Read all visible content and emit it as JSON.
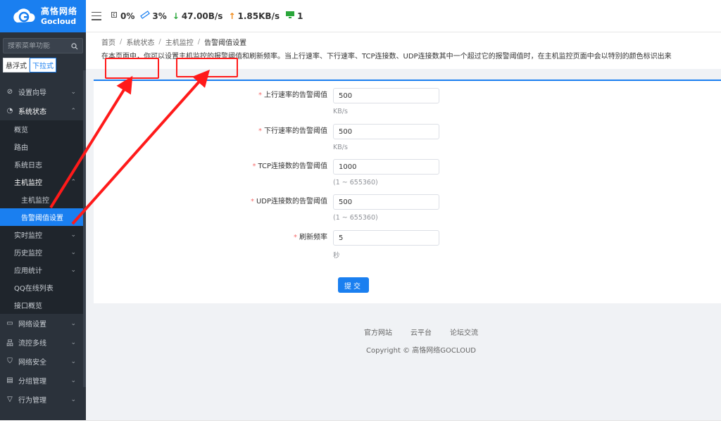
{
  "brand": {
    "cn": "高恪网络",
    "en": "Gocloud"
  },
  "sidebar": {
    "search_placeholder": "搜索菜单功能",
    "mode_float": "悬浮式",
    "mode_dropdown": "下拉式",
    "menu": [
      {
        "label": "设置向导",
        "icon": "compass-icon"
      },
      {
        "label": "系统状态",
        "icon": "gauge-icon"
      }
    ],
    "system_status_items": [
      "概览",
      "路由",
      "系统日志"
    ],
    "host_monitor": "主机监控",
    "host_monitor_items": [
      "主机监控",
      "告警阈值设置"
    ],
    "more_sub": [
      "实时监控",
      "历史监控",
      "应用统计",
      "QQ在线列表",
      "接口概览"
    ],
    "bottom_menu": [
      {
        "label": "网络设置",
        "icon": "monitor-icon"
      },
      {
        "label": "流控多线",
        "icon": "network-icon"
      },
      {
        "label": "网络安全",
        "icon": "shield-icon"
      },
      {
        "label": "分组管理",
        "icon": "document-icon"
      },
      {
        "label": "行为管理",
        "icon": "filter-icon"
      }
    ]
  },
  "topbar": {
    "cpu": "0%",
    "mem": "3%",
    "down": "47.00B/s",
    "up": "1.85KB/s",
    "devices": "1",
    "colors": {
      "down": "#2aa63a",
      "up": "#f08a1a",
      "device": "#2aa63a"
    }
  },
  "breadcrumb": [
    "首页",
    "系统状态",
    "主机监控",
    "告警阈值设置"
  ],
  "description": "在本页面中，你可以设置主机监控的报警阈值和刷新频率。当上行速率、下行速率、TCP连接数、UDP连接数其中一个超过它的报警阈值时，在主机监控页面中会以特别的颜色标识出来",
  "form": {
    "fields": [
      {
        "label": "上行速率的告警阈值",
        "value": "500",
        "hint": "KB/s"
      },
      {
        "label": "下行速率的告警阈值",
        "value": "500",
        "hint": "KB/s"
      },
      {
        "label": "TCP连接数的告警阈值",
        "value": "1000",
        "hint": "(1 ~ 655360)"
      },
      {
        "label": "UDP连接数的告警阈值",
        "value": "500",
        "hint": "(1 ~ 655360)"
      },
      {
        "label": "刷新频率",
        "value": "5",
        "hint": "秒"
      }
    ],
    "submit": "提交"
  },
  "footer": {
    "links": [
      "官方网站",
      "云平台",
      "论坛交流"
    ],
    "copyright": "Copyright © 高恪网络GOCLOUD"
  },
  "accent": "#1a7ff0"
}
